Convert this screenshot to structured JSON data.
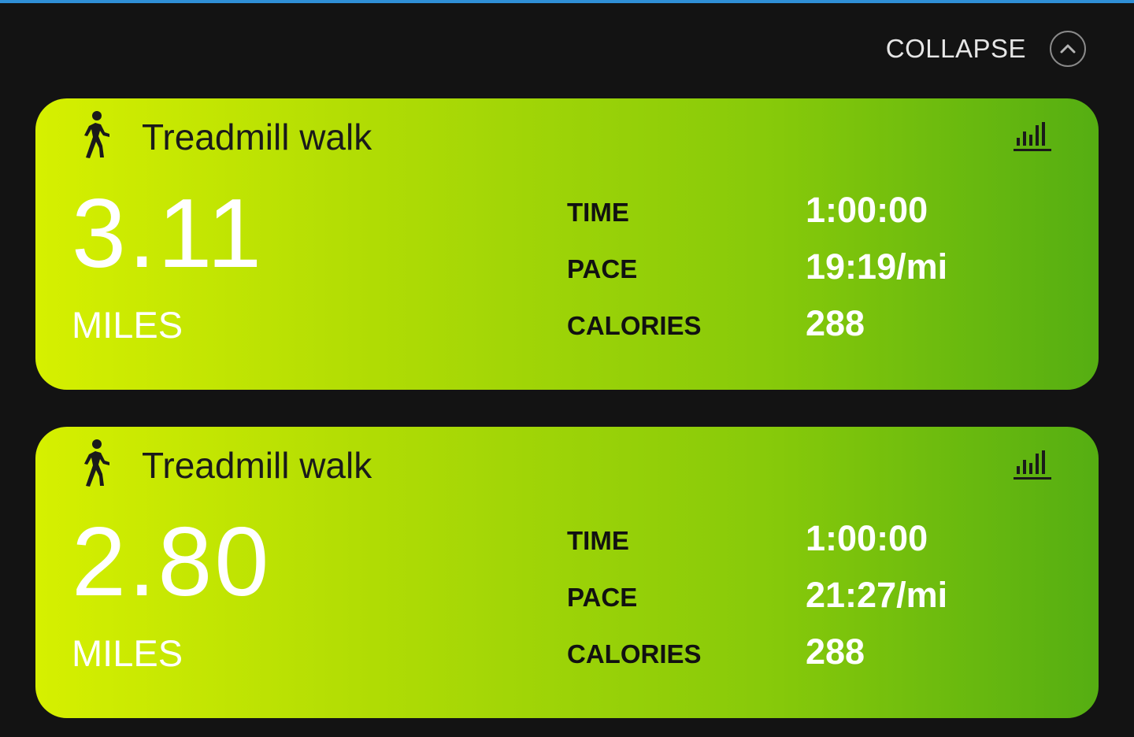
{
  "header": {
    "collapse_label": "COLLAPSE"
  },
  "icons": {
    "activity": "walking-person-icon",
    "stats": "bar-chart-icon",
    "collapse": "chevron-up-icon"
  },
  "colors": {
    "top_accent": "#2f8fd6",
    "card_gradient_start": "#d6f000",
    "card_gradient_end": "#55ae12",
    "background": "#131313"
  },
  "activities": [
    {
      "title": "Treadmill walk",
      "distance": "3.11",
      "distance_unit": "MILES",
      "stats": [
        {
          "label": "TIME",
          "value": "1:00:00"
        },
        {
          "label": "PACE",
          "value": "19:19/mi"
        },
        {
          "label": "CALORIES",
          "value": "288"
        }
      ]
    },
    {
      "title": "Treadmill walk",
      "distance": "2.80",
      "distance_unit": "MILES",
      "stats": [
        {
          "label": "TIME",
          "value": "1:00:00"
        },
        {
          "label": "PACE",
          "value": "21:27/mi"
        },
        {
          "label": "CALORIES",
          "value": "288"
        }
      ]
    }
  ]
}
